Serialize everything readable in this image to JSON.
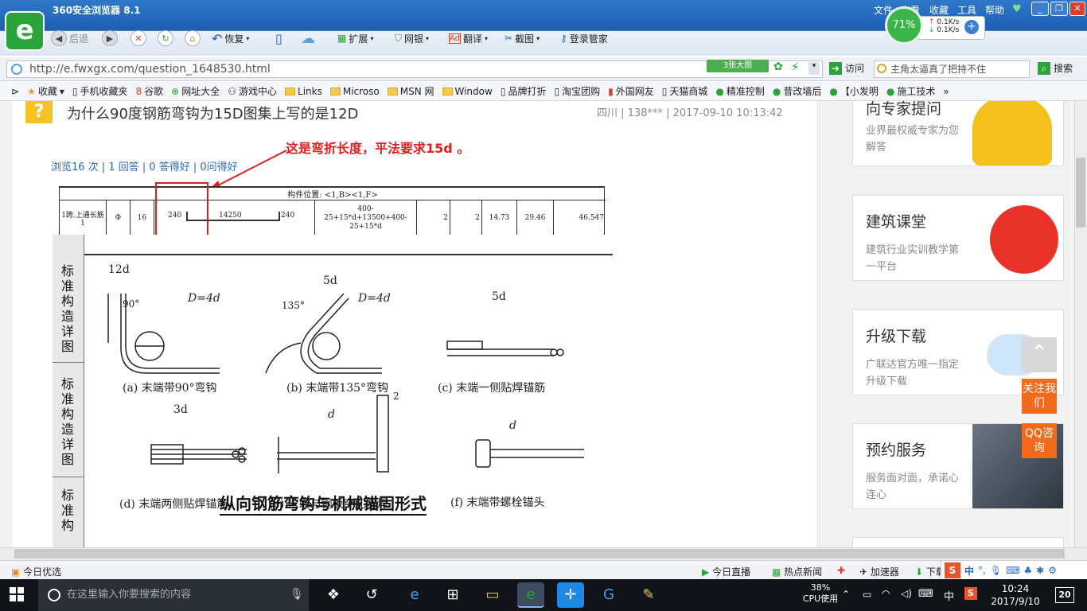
{
  "browser": {
    "title": "360安全浏览器 8.1",
    "menu": [
      "文件",
      "查看",
      "收藏",
      "工具",
      "帮助"
    ],
    "toolbar": {
      "back": "后退",
      "restore": "恢复",
      "extend": "扩展",
      "bank": "网银",
      "translate": "翻译",
      "screenshot": "截图",
      "login": "登录管家"
    },
    "speed": {
      "percent": "71%",
      "up": "0.1K/s",
      "down": "0.1K/s"
    },
    "address": {
      "url": "http://e.fwxgx.com/question_1648530.html",
      "big_images": "3张大图",
      "visit": "访问",
      "search_placeholder": "主角太逼真了把持不住",
      "search_button": "搜索"
    },
    "favorites": [
      "收藏",
      "手机收藏夹",
      "谷歌",
      "网址大全",
      "游戏中心",
      "Links",
      "Microso",
      "MSN 网",
      "Window",
      "品牌打折",
      "淘宝团购",
      "外国网友",
      "天猫商城",
      "精准控制",
      "昔改墙后",
      "【小发明",
      "施工技术"
    ]
  },
  "question": {
    "title": "为什么90度钢筋弯钩为15D图集上写的是12D",
    "meta": "四川 | 138*** | 2017-09-10 10:13:42",
    "stats": "浏览16 次 | 1 回答 | 0 答得好 | 0问得好",
    "annotation": "这是弯折长度，平法要求15d 。"
  },
  "rebar_table": {
    "position": "构件位置: <1,B><1,F>",
    "row": {
      "name": "1跨.上通长筋1",
      "grade": "Φ",
      "diameter": "16",
      "bend_left": "240",
      "length": "14250",
      "bend_right": "240",
      "formula": "400-25+15*d+13500+400-25+15*d",
      "count1": "2",
      "count2": "2",
      "single_len": "14.73",
      "total_len": "29.46",
      "weight": "46.547"
    }
  },
  "drawing": {
    "side_labels": [
      "标准构造详图",
      "标准构造详图",
      "标准构"
    ],
    "captions": {
      "a": "(a) 末端带90°弯钩",
      "b": "(b) 末端带135°弯钩",
      "c": "(c) 末端一侧贴焊锚筋",
      "d": "(d) 末端两侧贴焊锚筋",
      "e": "(e) 末端与钢板穿孔塞焊",
      "f": "(f) 末端带螺栓锚头"
    },
    "labels": {
      "d12": "12d",
      "angle90": "90°",
      "D4d": "D=4d",
      "d5": "5d",
      "angle135": "135°",
      "d3": "3d",
      "d": "d",
      "two": "2"
    },
    "title": "纵向钢筋弯钩与机械锚固形式"
  },
  "sidebar": [
    {
      "title": "向专家提问",
      "sub": "业界最权威专家为您解答"
    },
    {
      "title": "建筑课堂",
      "sub": "建筑行业实训教学第一平台"
    },
    {
      "title": "升级下载",
      "sub": "广联达官方唯一指定升级下载"
    },
    {
      "title": "预约服务",
      "sub": "服务面对面，承诺心连心"
    }
  ],
  "float_buttons": {
    "follow": "关注我们",
    "qq": "QQ咨询"
  },
  "statusbar": {
    "left": "今日优选",
    "live": "今日直播",
    "news": "热点新闻",
    "accel": "加速器",
    "download": "下载"
  },
  "taskbar": {
    "search_placeholder": "在这里输入你要搜索的内容",
    "cpu_percent": "38%",
    "cpu_label": "CPU使用",
    "ime": "中",
    "time": "10:24",
    "date": "2017/9/10",
    "notifications": "20"
  },
  "colors": {
    "brand_green": "#2aa33a",
    "accent_blue": "#2a6bc0",
    "annotation_red": "#e02020",
    "float_orange": "#f26b1d"
  }
}
